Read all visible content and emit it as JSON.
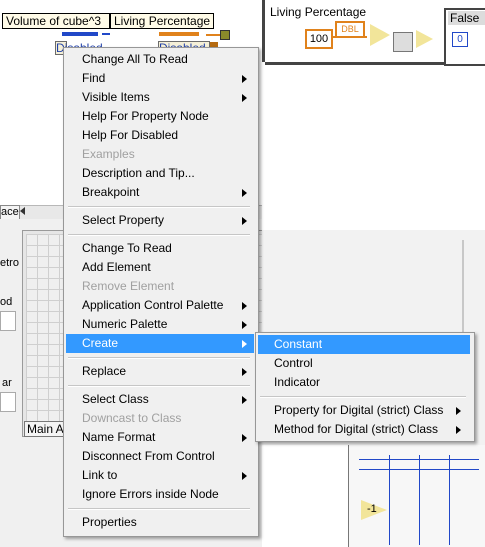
{
  "block_diagram": {
    "left_node_1": "Volume of cube^3",
    "left_node_2": "Living Percentage",
    "left_row_1": "Disabled",
    "left_row_2": "Disabled",
    "right_label": "Living Percentage",
    "right_constant": "100",
    "right_type_badge": "DBL",
    "right_case_label": "False",
    "right_index": "0",
    "tab_label": "ace",
    "main_tab": "Main A",
    "cut_labels": [
      "etro",
      "od",
      "ar"
    ],
    "minus_one": "-1"
  },
  "context_menu": {
    "groups": [
      [
        {
          "label": "Change All To Read",
          "submenu": false,
          "disabled": false
        },
        {
          "label": "Find",
          "submenu": true,
          "disabled": false
        },
        {
          "label": "Visible Items",
          "submenu": true,
          "disabled": false
        },
        {
          "label": "Help For Property Node",
          "submenu": false,
          "disabled": false
        },
        {
          "label": "Help For Disabled",
          "submenu": false,
          "disabled": false
        },
        {
          "label": "Examples",
          "submenu": false,
          "disabled": true
        },
        {
          "label": "Description and Tip...",
          "submenu": false,
          "disabled": false
        },
        {
          "label": "Breakpoint",
          "submenu": true,
          "disabled": false
        }
      ],
      [
        {
          "label": "Select Property",
          "submenu": true,
          "disabled": false
        }
      ],
      [
        {
          "label": "Change To Read",
          "submenu": false,
          "disabled": false
        },
        {
          "label": "Add Element",
          "submenu": false,
          "disabled": false
        },
        {
          "label": "Remove Element",
          "submenu": false,
          "disabled": true
        },
        {
          "label": "Application Control Palette",
          "submenu": true,
          "disabled": false
        },
        {
          "label": "Numeric Palette",
          "submenu": true,
          "disabled": false
        },
        {
          "label": "Create",
          "submenu": true,
          "disabled": false,
          "highlighted": true
        }
      ],
      [
        {
          "label": "Replace",
          "submenu": true,
          "disabled": false
        }
      ],
      [
        {
          "label": "Select Class",
          "submenu": true,
          "disabled": false
        },
        {
          "label": "Downcast to Class",
          "submenu": false,
          "disabled": true
        },
        {
          "label": "Name Format",
          "submenu": true,
          "disabled": false
        },
        {
          "label": "Disconnect From Control",
          "submenu": false,
          "disabled": false
        },
        {
          "label": "Link to",
          "submenu": true,
          "disabled": false
        },
        {
          "label": "Ignore Errors inside Node",
          "submenu": false,
          "disabled": false
        }
      ],
      [
        {
          "label": "Properties",
          "submenu": false,
          "disabled": false
        }
      ]
    ]
  },
  "create_submenu": {
    "groups": [
      [
        {
          "label": "Constant",
          "submenu": false,
          "highlighted": true
        },
        {
          "label": "Control",
          "submenu": false
        },
        {
          "label": "Indicator",
          "submenu": false
        }
      ],
      [
        {
          "label": "Property for Digital (strict) Class",
          "submenu": true
        },
        {
          "label": "Method for Digital (strict) Class",
          "submenu": true
        }
      ]
    ]
  },
  "colors": {
    "highlight": "#3399ff",
    "menu_bg": "#f0f0f0",
    "disabled_text": "#a0a0a0",
    "wire_orange": "#e0821c",
    "wire_blue": "#2148c8"
  }
}
